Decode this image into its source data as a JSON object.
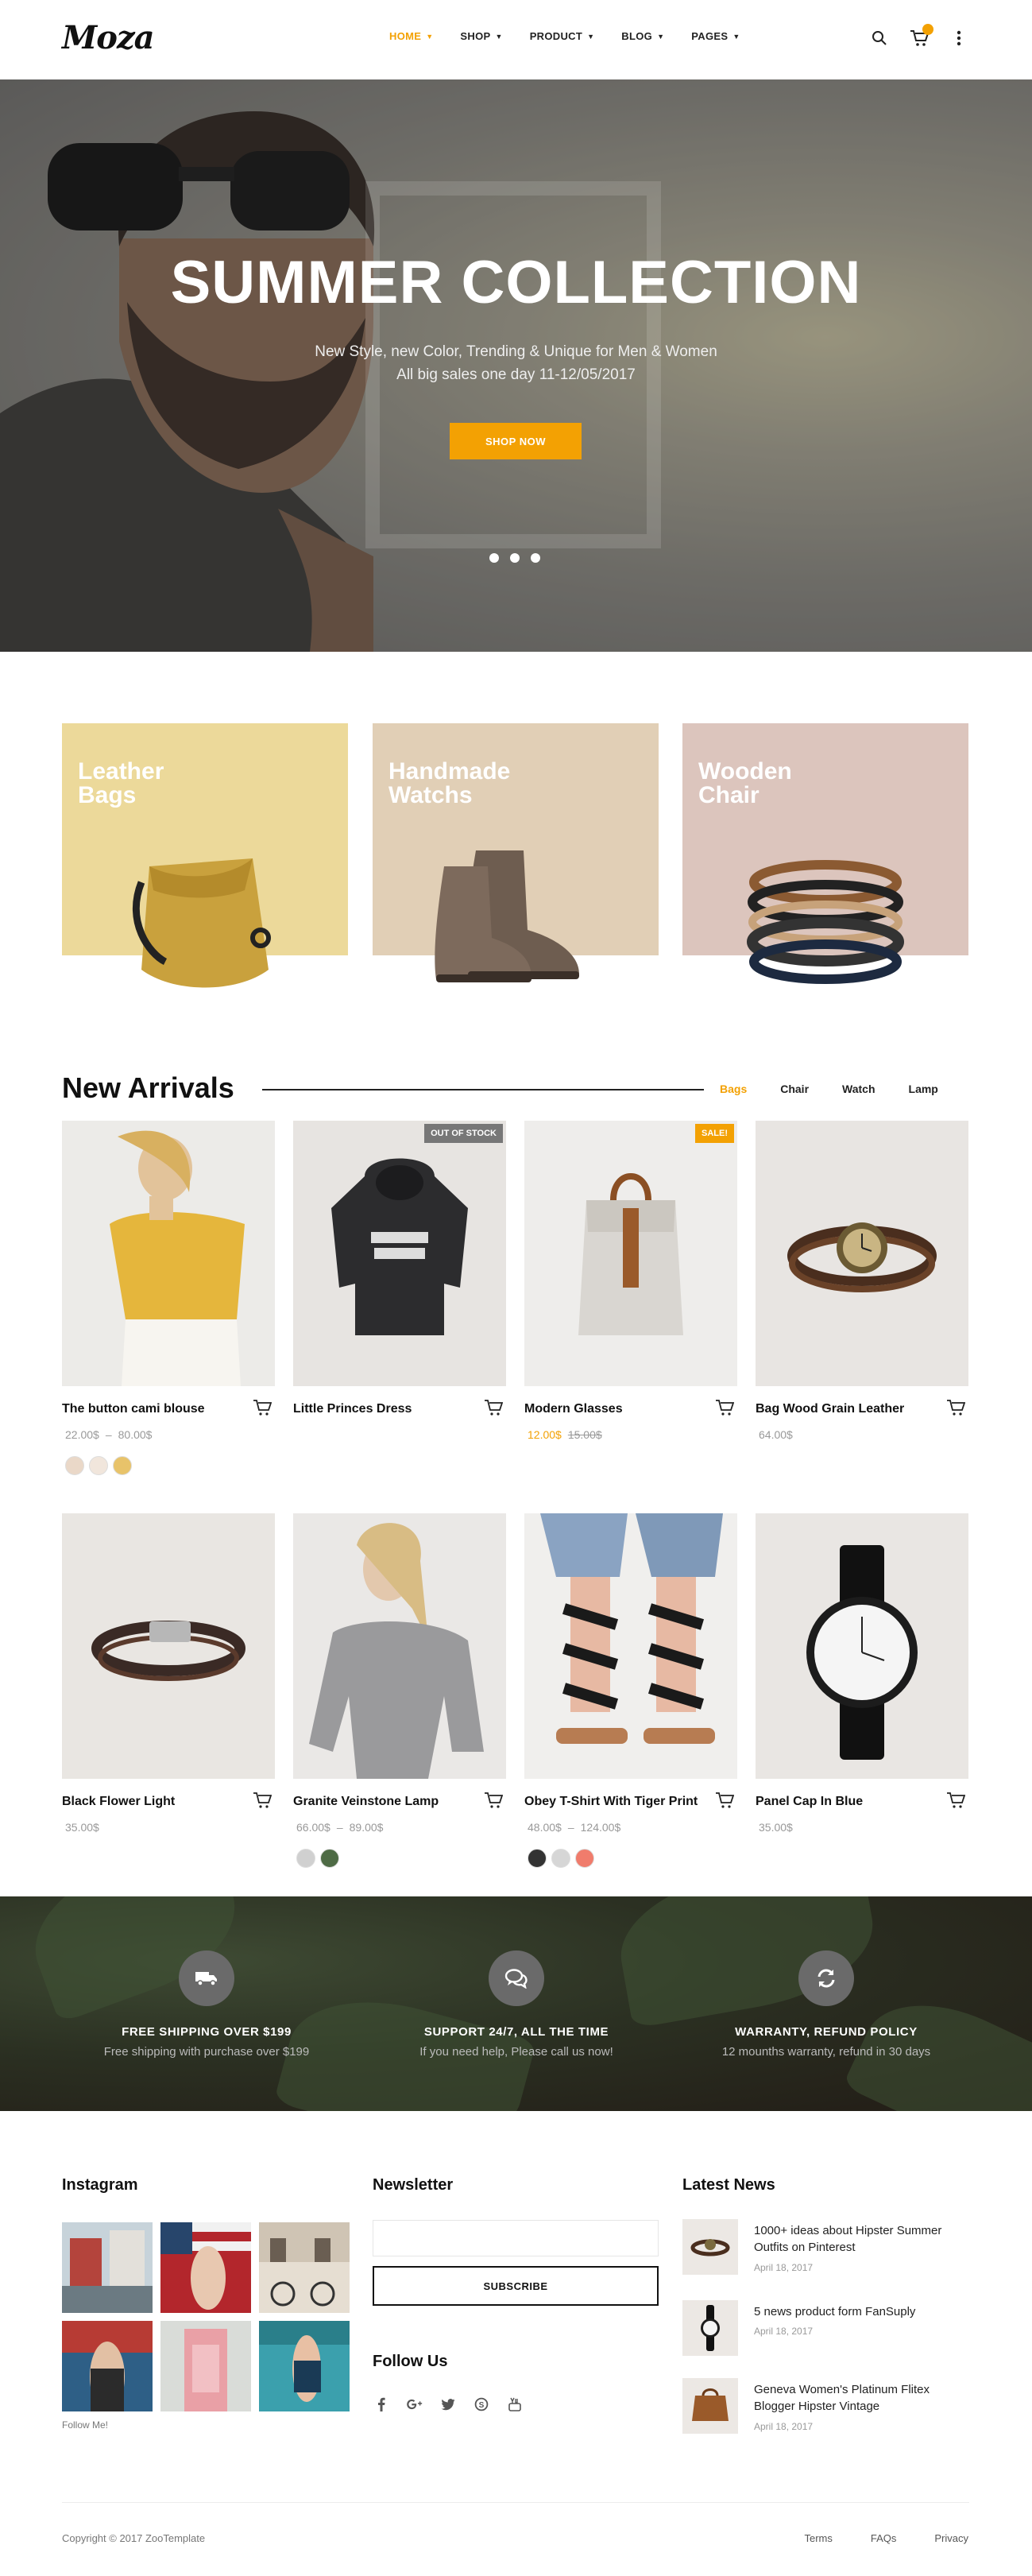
{
  "brand": {
    "logo": "Moza",
    "accent": "#f3a103"
  },
  "nav": [
    {
      "label": "HOME",
      "active": true
    },
    {
      "label": "SHOP"
    },
    {
      "label": "PRODUCT"
    },
    {
      "label": "BLOG"
    },
    {
      "label": "PAGES"
    }
  ],
  "header_icons": [
    "search-icon",
    "cart-icon",
    "more-vertical-icon"
  ],
  "hero": {
    "title": "SUMMER COLLECTION",
    "subtitle_1": "New Style, new Color, Trending & Unique for Men & Women",
    "subtitle_2": "All big sales one day 11-12/05/2017",
    "button": "SHOP NOW"
  },
  "categories": [
    {
      "line1": "Leather",
      "line2": "Bags",
      "color": "#ecd99a"
    },
    {
      "line1": "Handmade",
      "line2": "Watchs",
      "color": "#e1cfb6"
    },
    {
      "line1": "Wooden",
      "line2": "Chair",
      "color": "#dcc5bd"
    }
  ],
  "arrivals": {
    "title": "New Arrivals",
    "tabs": [
      {
        "label": "Bags",
        "active": true
      },
      {
        "label": "Chair"
      },
      {
        "label": "Watch"
      },
      {
        "label": "Lamp"
      }
    ]
  },
  "products": [
    {
      "name": "The button cami blouse",
      "price": "22.00$",
      "price_to": "80.00$",
      "swatches": [
        "#ead8c8",
        "#f1e6dc",
        "#e8c36a"
      ]
    },
    {
      "name": "Little Princes Dress",
      "badge": "OUT OF STOCK",
      "badge_color": "#777777"
    },
    {
      "name": "Modern Glasses",
      "badge": "SALE!",
      "badge_color": "#f3a103",
      "price": "12.00$",
      "price_old": "15.00$"
    },
    {
      "name": "Bag Wood Grain Leather",
      "price": "64.00$"
    },
    {
      "name": "Black Flower Light",
      "price": "35.00$"
    },
    {
      "name": "Granite Veinstone Lamp",
      "price": "66.00$",
      "price_to": "89.00$",
      "swatches": [
        "#d0d0d0",
        "#4e6b45"
      ]
    },
    {
      "name": "Obey T-Shirt With Tiger Print",
      "price": "48.00$",
      "price_to": "124.00$",
      "swatches": [
        "#333333",
        "#d6d6d6",
        "#f07c6c"
      ]
    },
    {
      "name": "Panel Cap In Blue",
      "price": "35.00$"
    }
  ],
  "services": [
    {
      "icon": "truck-icon",
      "title": "FREE SHIPPING OVER $199",
      "sub": "Free shipping with purchase over $199"
    },
    {
      "icon": "chat-bubbles-icon",
      "title": "SUPPORT 24/7, ALL THE TIME",
      "sub": "If you need help, Please call us now!"
    },
    {
      "icon": "refresh-icon",
      "title": "WARRANTY, REFUND POLICY",
      "sub": "12 mounths warranty, refund in 30 days"
    }
  ],
  "footer": {
    "instagram_title": "Instagram",
    "follow_me": "Follow Me!",
    "newsletter_title": "Newsletter",
    "newsletter_placeholder": "",
    "subscribe": "SUBSCRIBE",
    "follow_us": "Follow Us",
    "social": [
      "facebook-icon",
      "google-plus-icon",
      "twitter-icon",
      "skype-icon",
      "youtube-icon"
    ],
    "news_title": "Latest News",
    "news": [
      {
        "title": "1000+ ideas about Hipster Summer Outfits on Pinterest",
        "date": "April 18, 2017"
      },
      {
        "title": "5 news product form FanSuply",
        "date": "April 18, 2017"
      },
      {
        "title": "Geneva Women's Platinum Flitex Blogger Hipster Vintage",
        "date": "April 18, 2017"
      }
    ],
    "copyright": "Copyright © 2017 ZooTemplate",
    "links": [
      "Terms",
      "FAQs",
      "Privacy"
    ]
  }
}
